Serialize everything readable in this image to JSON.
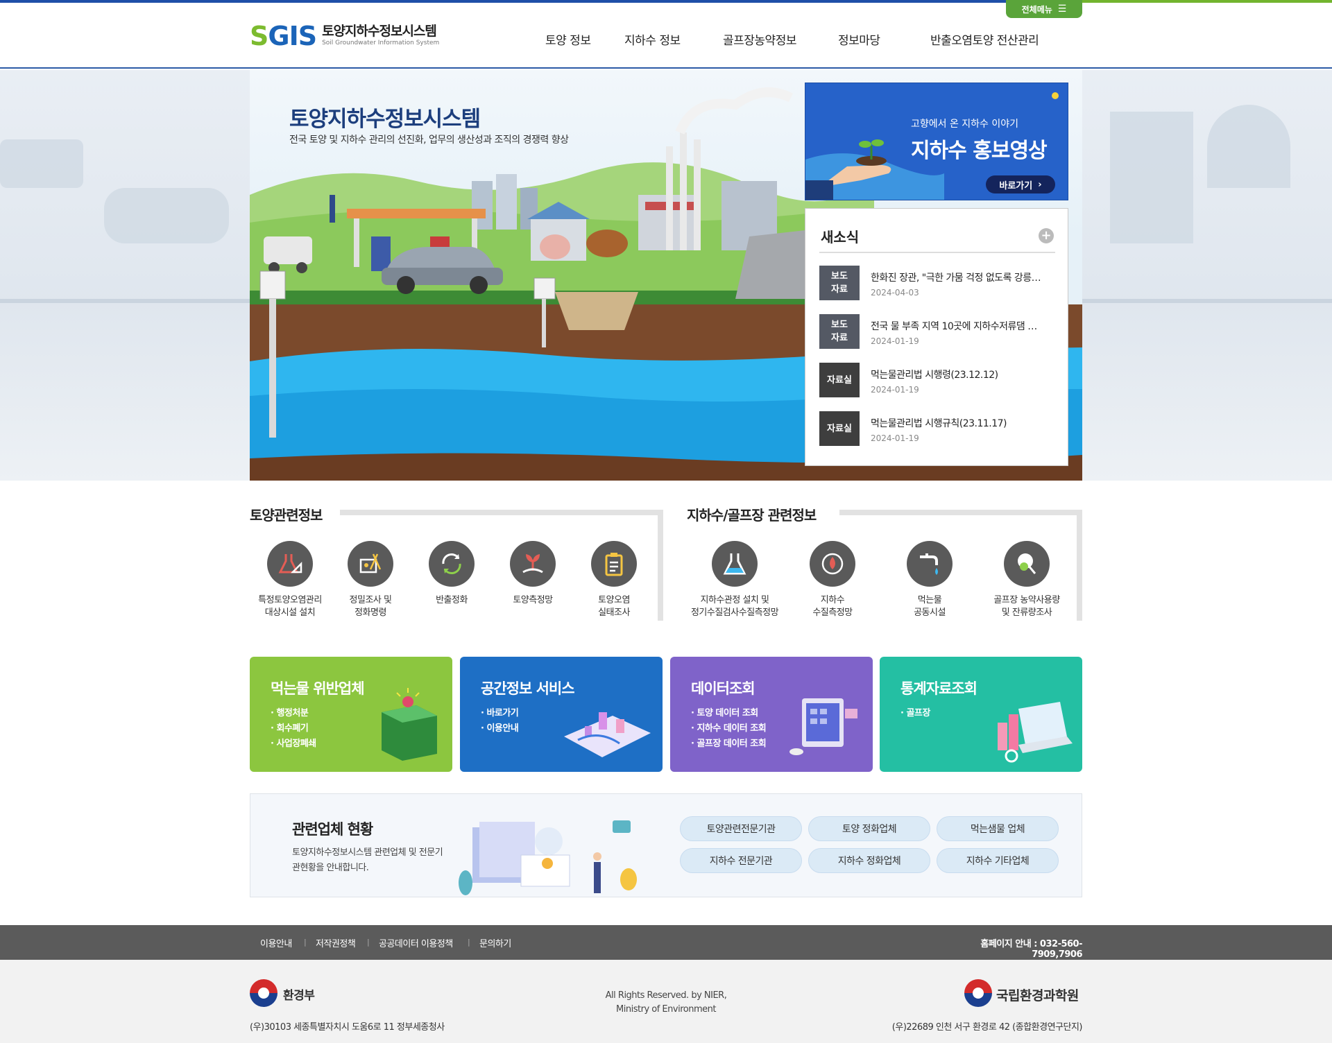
{
  "header": {
    "logo_mark_1": "S",
    "logo_mark_2": "GIS",
    "logo_title": "토양지하수정보시스템",
    "logo_sub": "Soil Groundwater Information System",
    "all_menu": "전체메뉴",
    "nav": [
      "토양 정보",
      "지하수 정보",
      "골프장농약정보",
      "정보마당",
      "반출오염토양 전산관리"
    ]
  },
  "hero": {
    "title": "토양지하수정보시스템",
    "subtitle": "전국 토양 및 지하수 관리의 선진화, 업무의 생산성과 조직의 경쟁력 향상"
  },
  "promo": {
    "tagline": "고향에서 온 지하수 이야기",
    "title": "지하수 홍보영상",
    "button": "바로가기"
  },
  "news": {
    "title": "새소식",
    "more": "+",
    "items": [
      {
        "badge": "보도\n자료",
        "text": "한화진 장관, \"극한 가뭄 걱정 없도록 강릉…",
        "date": "2024-04-03"
      },
      {
        "badge": "보도\n자료",
        "text": "전국 물 부족 지역 10곳에 지하수저류댐 …",
        "date": "2024-01-19"
      },
      {
        "badge": "자료실",
        "text": "먹는물관리법 시행령(23.12.12)",
        "date": "2024-01-19"
      },
      {
        "badge": "자료실",
        "text": "먹는물관리법 시행규칙(23.11.17)",
        "date": "2024-01-19"
      }
    ]
  },
  "soil_section": {
    "title": "토양관련정보",
    "items": [
      "특정토양오염관리\n대상시설 설치",
      "정밀조사 및\n정화명령",
      "반출정화",
      "토양측정망",
      "토양오염\n실태조사"
    ]
  },
  "water_section": {
    "title": "지하수/골프장 관련정보",
    "items": [
      "지하수관정 설치 및\n정기수질검사수질측정망",
      "지하수\n수질측정망",
      "먹는물\n공동시설",
      "골프장 농약사용량\n및 잔류량조사"
    ]
  },
  "cards": [
    {
      "title": "먹는물 위반업체",
      "items": [
        "· 행정처분",
        "· 회수폐기",
        "· 사업장폐쇄"
      ],
      "color": "#8cc63f"
    },
    {
      "title": "공간정보 서비스",
      "items": [
        "· 바로가기",
        "· 이용안내"
      ],
      "color": "#1e6fc5"
    },
    {
      "title": "데이터조회",
      "items": [
        "· 토양 데이터 조회",
        "· 지하수 데이터 조회",
        "· 골프장 데이터 조회"
      ],
      "color": "#7f63c9"
    },
    {
      "title": "통계자료조회",
      "items": [
        "· 골프장"
      ],
      "color": "#24bfa3"
    }
  ],
  "related": {
    "title": "관련업체 현황",
    "desc": "토양지하수정보시스템 관련업체 및 전문기관현황을 안내합니다.",
    "pills": [
      "토양관련전문기관",
      "토양 정화업체",
      "먹는샘물 업체",
      "지하수 전문기관",
      "지하수 정화업체",
      "지하수 기타업체"
    ]
  },
  "footer": {
    "links": [
      "이용안내",
      "저작권정책",
      "공공데이터 이용정책",
      "문의하기"
    ],
    "tel": "홈페이지 안내 : 032-560-7909,7906",
    "org_left": "환경부",
    "addr_left": "(우)30103 세종특별자치시 도움6로 11 정부세종청사",
    "copyright": "All Rights Reserved. by NIER,\nMinistry of Environment",
    "org_right": "국립환경과학원",
    "addr_right": "(우)22689 인천 서구 환경로 42 (종합환경연구단지)"
  }
}
